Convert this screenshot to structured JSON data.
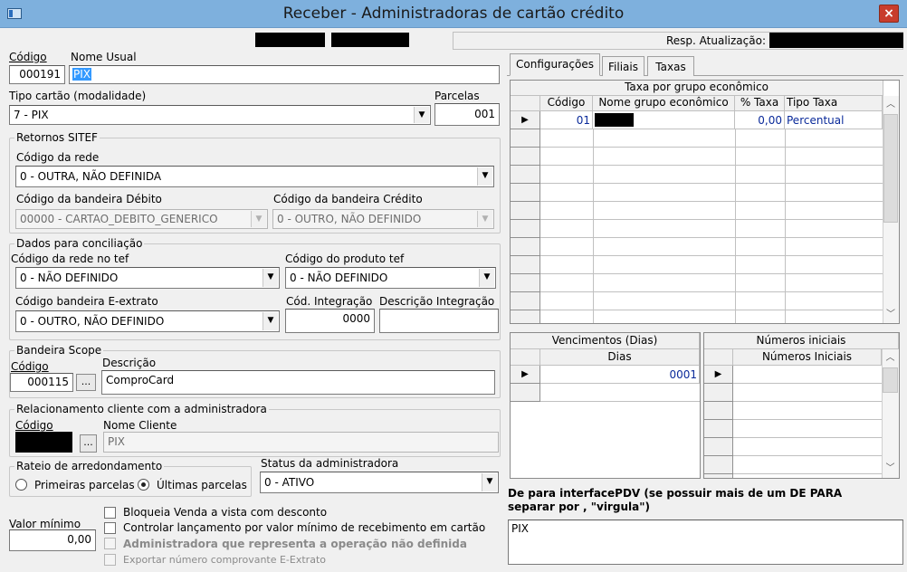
{
  "window": {
    "title": "Receber - Administradoras de cartão crédito",
    "close_glyph": "×"
  },
  "header": {
    "resp_label": "Resp. Atualização:"
  },
  "codigo": {
    "label": "Código",
    "value": "000191"
  },
  "nome_usual": {
    "label": "Nome Usual",
    "value": "PIX"
  },
  "tipo_cartao": {
    "label": "Tipo cartão (modalidade)",
    "value": "7 - PIX"
  },
  "parcelas": {
    "label": "Parcelas",
    "value": "001"
  },
  "retornos": {
    "title": "Retornos SITEF",
    "codigo_rede_label": "Código da rede",
    "codigo_rede_value": "0 - OUTRA, NÃO DEFINIDA",
    "bandeira_debito_label": "Código da bandeira Débito",
    "bandeira_debito_value": "00000 - CARTAO_DEBITO_GENERICO",
    "bandeira_credito_label": "Código da bandeira Crédito",
    "bandeira_credito_value": "0 - OUTRO, NÃO DEFINIDO"
  },
  "conciliacao": {
    "title": "Dados para conciliação",
    "rede_tef_label": "Código da rede no tef",
    "rede_tef_value": "0 - NÃO DEFINIDO",
    "produto_tef_label": "Código do produto tef",
    "produto_tef_value": "0 - NÃO DEFINIDO",
    "bandeira_extrato_label": "Código bandeira E-extrato",
    "bandeira_extrato_value": "0 - OUTRO, NÃO DEFINIDO",
    "cod_integracao_label": "Cód. Integração",
    "cod_integracao_value": "0000",
    "desc_integracao_label": "Descrição Integração",
    "desc_integracao_value": ""
  },
  "scope": {
    "title": "Bandeira Scope",
    "codigo_label": "Código",
    "codigo_value": "000115",
    "lookup": "...",
    "descricao_label": "Descrição",
    "descricao_value": "ComproCard"
  },
  "relacionamento": {
    "title": "Relacionamento cliente com a administradora",
    "codigo_label": "Código",
    "lookup": "...",
    "nome_label": "Nome Cliente",
    "nome_value": "PIX"
  },
  "rateio": {
    "title": "Rateio de arredondamento",
    "opt1": "Primeiras parcelas",
    "opt2": "Últimas parcelas",
    "selected": "Últimas parcelas"
  },
  "status": {
    "label": "Status da administradora",
    "value": "0 - ATIVO"
  },
  "valor_minimo": {
    "label": "Valor mínimo",
    "value": "0,00"
  },
  "checks": [
    {
      "label": "Bloqueia Venda a vista com desconto",
      "checked": false,
      "enabled": true
    },
    {
      "label": "Controlar lançamento por valor mínimo de recebimento em cartão",
      "checked": false,
      "enabled": true
    },
    {
      "label": "Administradora que representa a operação não definida",
      "checked": false,
      "enabled": false
    },
    {
      "label": "Exportar número comprovante E-Extrato",
      "checked": false,
      "enabled": false
    }
  ],
  "tabs": [
    {
      "label": "Configurações",
      "active": true
    },
    {
      "label": "Filiais",
      "active": false
    },
    {
      "label": "Taxas",
      "active": false
    }
  ],
  "taxa_grid": {
    "title": "Taxa por grupo econômico",
    "columns": [
      "Código",
      "Nome grupo econômico",
      "% Taxa",
      "Tipo Taxa"
    ],
    "rows": [
      {
        "codigo": "01",
        "taxa": "0,00",
        "tipo": "Percentual"
      }
    ]
  },
  "vencimentos": {
    "title": "Vencimentos (Dias)",
    "column": "Dias",
    "rows": [
      "0001"
    ]
  },
  "numeros": {
    "title": "Números iniciais",
    "column": "Números Iniciais"
  },
  "depara": {
    "label": "De para interfacePDV  (se possuir mais de um DE PARA separar por , \"virgula\")",
    "value": "PIX"
  },
  "icons": {
    "dropdown": "▼",
    "scroll_up": "︿",
    "scroll_down": "﹀",
    "row_pointer": "▶"
  }
}
